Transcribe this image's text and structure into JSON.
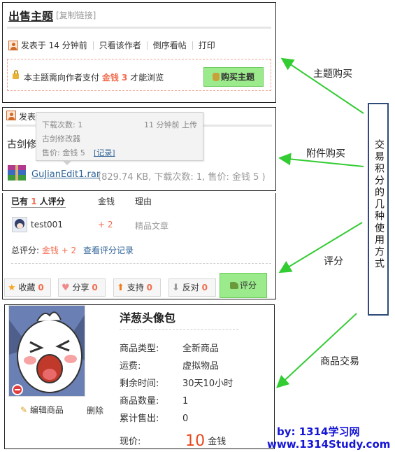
{
  "thread": {
    "title": "出售主题",
    "copy_link": "[复制链接]",
    "posted": "发表于 14 分钟前",
    "only_author": "只看该作者",
    "reverse": "倒序看帖",
    "print": "打印",
    "pay_notice_pre": "本主题需向作者支付",
    "pay_notice_amount": "金钱 3",
    "pay_notice_post": "才能浏览",
    "buy_btn": "购买主题"
  },
  "attachment": {
    "posted_partial": "发表",
    "body_partial": "古剑修",
    "tooltip": {
      "downloads": "下载次数: 1",
      "uploaded": "11 分钟前 上传",
      "desc": "古剑修改器",
      "price": "售价: 金钱 5",
      "record": "[记录]"
    },
    "file_name": "GuJianEdit1.rar",
    "file_meta": "(829.74 KB, 下载次数: 1, 售价: 金钱 5 )"
  },
  "rating": {
    "header_pre": "已有",
    "header_count": "1",
    "header_post": "人评分",
    "col_money": "金钱",
    "col_reason": "理由",
    "row": {
      "user": "test001",
      "money": "+ 2",
      "reason": "精品文章"
    },
    "total_label": "总评分:",
    "total_value": "金钱 + 2",
    "view_log": "查看评分记录",
    "buttons": {
      "fav": "收藏",
      "fav_n": "0",
      "share": "分享",
      "share_n": "0",
      "support": "支持",
      "support_n": "0",
      "oppose": "反对",
      "oppose_n": "0",
      "rate": "评分"
    }
  },
  "goods": {
    "name": "洋葱头像包",
    "edit": "编辑商品",
    "delete": "删除",
    "fields": [
      {
        "k": "商品类型:",
        "v": "全新商品"
      },
      {
        "k": "运费:",
        "v": "虚拟物品"
      },
      {
        "k": "剩余时间:",
        "v": "30天10小时"
      },
      {
        "k": "商品数量:",
        "v": "1"
      },
      {
        "k": "累计售出:",
        "v": "0"
      }
    ],
    "price_label": "现价:",
    "price_value": "10",
    "price_unit": "金钱"
  },
  "annotations": {
    "vertical_title": "交易积分的几种使用方式",
    "label_buy_topic": "主题购买",
    "label_attach": "附件购买",
    "label_rate": "评分",
    "label_trade": "商品交易",
    "credit_by": "by: 1314学习网",
    "credit_url": "www.1314Study.com"
  },
  "colors": {
    "accent_orange": "#f26c4f",
    "arrow_green": "#33cc33",
    "button_green": "#9bea8b",
    "link_blue": "#336699",
    "credit_blue": "#1515d6"
  }
}
